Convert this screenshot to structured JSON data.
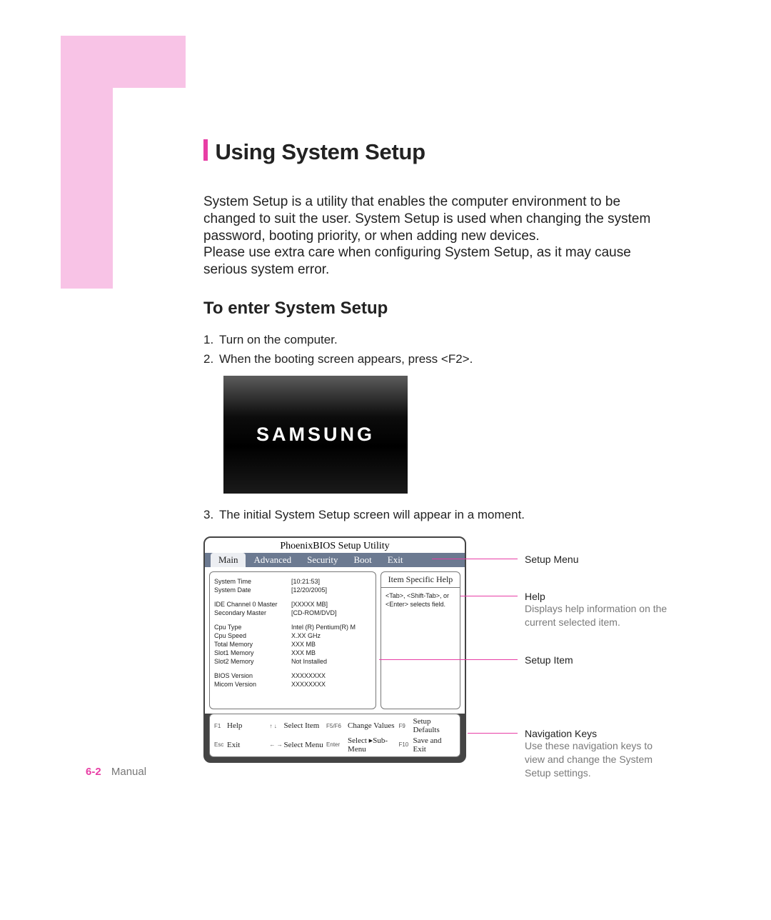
{
  "title": "Using System Setup",
  "intro": "System Setup is a utility that enables the computer environment to be changed to suit the user. System Setup is used when changing the system password, booting priority, or when adding new devices.\nPlease use extra care when configuring System Setup, as it may cause serious system error.",
  "subtitle": "To enter System Setup",
  "steps": {
    "s1": "Turn on the computer.",
    "s2": "When the booting screen appears, press <F2>.",
    "s3": "The initial System Setup screen will appear in a moment."
  },
  "logo": "SAMSUNG",
  "bios": {
    "utility_title": "PhoenixBIOS  Setup Utility",
    "tabs": {
      "main": "Main",
      "advanced": "Advanced",
      "security": "Security",
      "boot": "Boot",
      "exit": "Exit"
    },
    "help_title": "Item Specific Help",
    "help_body": "<Tab>, <Shift-Tab>, or <Enter> selects field.",
    "rows": {
      "time_k": "System Time",
      "time_v": "[10:21:53]",
      "date_k": "System Date",
      "date_v": "[12/20/2005]",
      "ide_k": "IDE Channel 0 Master",
      "ide_v": "[XXXXX MB]",
      "sec_k": "Secondary Master",
      "sec_v": "[CD-ROM/DVD]",
      "cput_k": "Cpu Type",
      "cput_v": "Intel (R) Pentium(R) M",
      "cpus_k": "Cpu Speed",
      "cpus_v": "X.XX GHz",
      "tmem_k": "Total Memory",
      "tmem_v": "XXX MB",
      "s1_k": "Slot1 Memory",
      "s1_v": "XXX MB",
      "s2_k": "Slot2 Memory",
      "s2_v": "Not Installed",
      "bios_k": "BIOS Version",
      "bios_v": "XXXXXXXX",
      "micom_k": "Micom Version",
      "micom_v": "XXXXXXXX"
    },
    "footer": {
      "f1_k": "F1",
      "f1_v": "Help",
      "ud_k": "↑ ↓",
      "ud_v": "Select Item",
      "cv_k": "F5/F6",
      "cv_v": "Change Values",
      "f9_k": "F9",
      "f9_v": "Setup Defaults",
      "esc_k": "Esc",
      "esc_v": "Exit",
      "lr_k": "← →",
      "lr_v": "Select Menu",
      "ent_k": "Enter",
      "ent_v": "Select ▸Sub-Menu",
      "f10_k": "F10",
      "f10_v": "Save and Exit"
    }
  },
  "annotations": {
    "menu": "Setup Menu",
    "help_t": "Help",
    "help_d": "Displays help information on the current selected item.",
    "item": "Setup Item",
    "nav_t": "Navigation Keys",
    "nav_d": "Use these navigation keys to view and change the System Setup settings."
  },
  "page_footer": {
    "num": "6-2",
    "label": "Manual"
  }
}
